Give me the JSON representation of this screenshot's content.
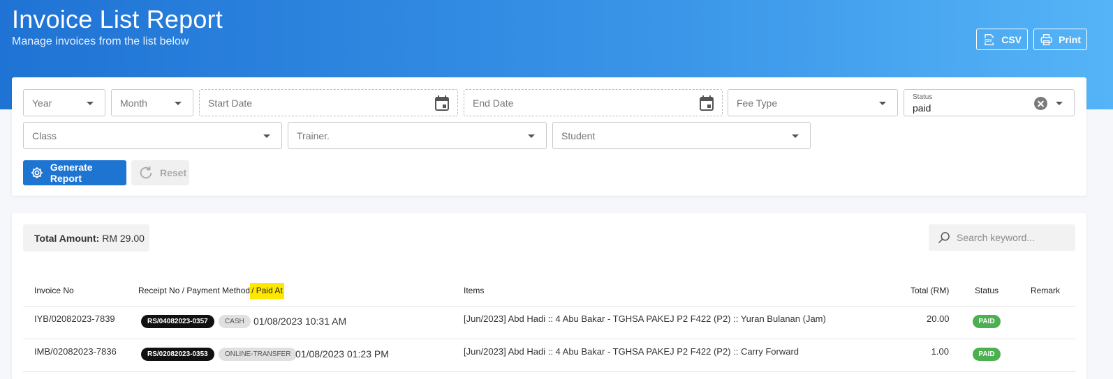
{
  "header": {
    "title": "Invoice List Report",
    "subtitle": "Manage invoices from the list below",
    "csv_label": "CSV",
    "print_label": "Print"
  },
  "filters": {
    "year_placeholder": "Year",
    "month_placeholder": "Month",
    "start_date_placeholder": "Start Date",
    "end_date_placeholder": "End Date",
    "fee_type_placeholder": "Fee Type",
    "status_label": "Status",
    "status_value": "paid",
    "class_placeholder": "Class",
    "trainer_placeholder": "Trainer.",
    "student_placeholder": "Student",
    "generate_label": "Generate Report",
    "reset_label": "Reset"
  },
  "summary": {
    "total_label": "Total Amount:",
    "total_value": "RM 29.00",
    "search_placeholder": "Search keyword..."
  },
  "table": {
    "columns": {
      "invoice_no": "Invoice No",
      "receipt_main": "Receipt No / Payment Method",
      "receipt_highlight": "/ Paid At",
      "items": "Items",
      "total": "Total (RM)",
      "status": "Status",
      "remark": "Remark"
    },
    "rows": [
      {
        "invoice_no": "IYB/02082023-7839",
        "receipt_no": "RS/04082023-0357",
        "method": "CASH",
        "paid_at": "01/08/2023 10:31 AM",
        "items": "[Jun/2023] Abd Hadi :: 4 Abu Bakar - TGHSA PAKEJ P2 F422 (P2) :: Yuran Bulanan (Jam)",
        "total": "20.00",
        "status": "PAID"
      },
      {
        "invoice_no": "IMB/02082023-7836",
        "receipt_no": "RS/02082023-0353",
        "method": "ONLINE-TRANSFER",
        "paid_at": "01/08/2023 01:23 PM",
        "items": "[Jun/2023] Abd Hadi :: 4 Abu Bakar - TGHSA PAKEJ P2 F422 (P2) :: Carry Forward",
        "total": "1.00",
        "status": "PAID"
      }
    ]
  },
  "colors": {
    "primary": "#1d74d1",
    "header_gradient_start": "#1f73d4",
    "header_gradient_end": "#55b4f7",
    "paid_badge": "#4caf50",
    "highlight": "#ffe800"
  }
}
